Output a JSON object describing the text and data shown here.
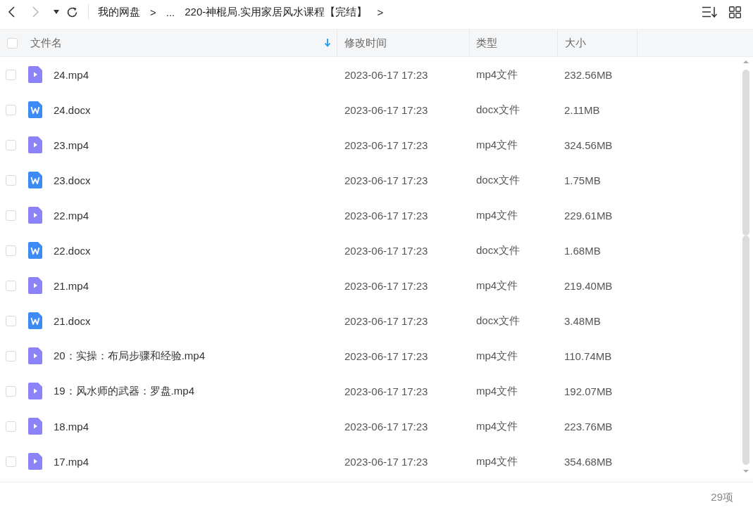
{
  "toolbar": {
    "breadcrumb": [
      "我的网盘",
      ">",
      "...",
      "220-神棍局.实用家居风水课程【完结】",
      ">"
    ]
  },
  "table": {
    "select_all_checked": false,
    "columns": [
      "文件名",
      "修改时间",
      "类型",
      "大小"
    ],
    "rows": [
      {
        "kind": "mp4",
        "checked": false,
        "name": "24.mp4",
        "modified": "2023-06-17 17:23",
        "type": "mp4文件",
        "size": "232.56MB"
      },
      {
        "kind": "docx",
        "checked": false,
        "name": "24.docx",
        "modified": "2023-06-17 17:23",
        "type": "docx文件",
        "size": "2.11MB"
      },
      {
        "kind": "mp4",
        "checked": false,
        "name": "23.mp4",
        "modified": "2023-06-17 17:23",
        "type": "mp4文件",
        "size": "324.56MB"
      },
      {
        "kind": "docx",
        "checked": false,
        "name": "23.docx",
        "modified": "2023-06-17 17:23",
        "type": "docx文件",
        "size": "1.75MB"
      },
      {
        "kind": "mp4",
        "checked": false,
        "name": "22.mp4",
        "modified": "2023-06-17 17:23",
        "type": "mp4文件",
        "size": "229.61MB"
      },
      {
        "kind": "docx",
        "checked": false,
        "name": "22.docx",
        "modified": "2023-06-17 17:23",
        "type": "docx文件",
        "size": "1.68MB"
      },
      {
        "kind": "mp4",
        "checked": false,
        "name": "21.mp4",
        "modified": "2023-06-17 17:23",
        "type": "mp4文件",
        "size": "219.40MB"
      },
      {
        "kind": "docx",
        "checked": false,
        "name": "21.docx",
        "modified": "2023-06-17 17:23",
        "type": "docx文件",
        "size": "3.48MB"
      },
      {
        "kind": "mp4",
        "checked": false,
        "name": "20：实操：布局步骤和经验.mp4",
        "modified": "2023-06-17 17:23",
        "type": "mp4文件",
        "size": "110.74MB"
      },
      {
        "kind": "mp4",
        "checked": false,
        "name": "19：风水师的武器：罗盘.mp4",
        "modified": "2023-06-17 17:23",
        "type": "mp4文件",
        "size": "192.07MB"
      },
      {
        "kind": "mp4",
        "checked": false,
        "name": "18.mp4",
        "modified": "2023-06-17 17:23",
        "type": "mp4文件",
        "size": "223.76MB"
      },
      {
        "kind": "mp4",
        "checked": false,
        "name": "17.mp4",
        "modified": "2023-06-17 17:23",
        "type": "mp4文件",
        "size": "354.68MB"
      }
    ]
  },
  "status_bar": {
    "count": "29项"
  }
}
